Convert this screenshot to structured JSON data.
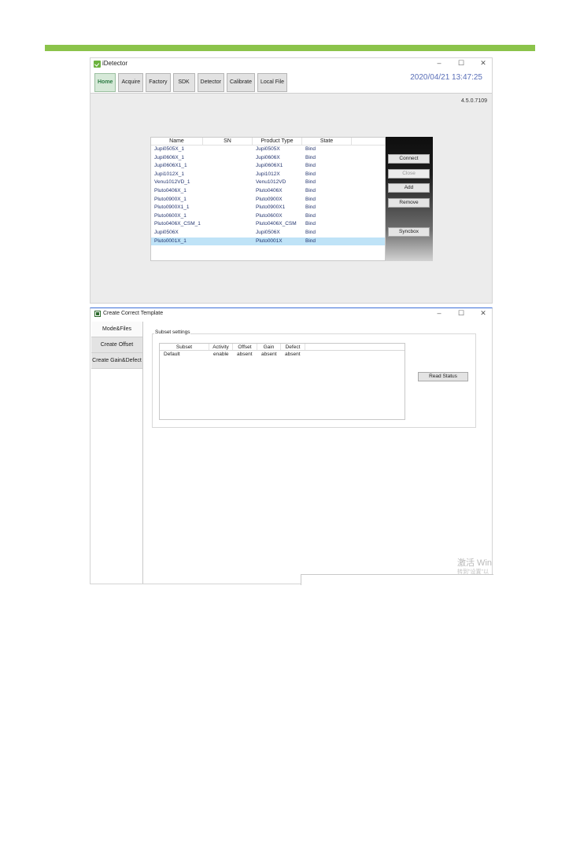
{
  "window1": {
    "title": "iDetector",
    "controls": [
      "–",
      "☐",
      "✕"
    ],
    "tabs": [
      "Home",
      "Acquire",
      "Factory",
      "SDK",
      "Detector",
      "Calibrate",
      "Local File"
    ],
    "active_tab": "Home",
    "datetime": "2020/04/21 13:47:25",
    "version": "4.5.0.7109",
    "list": {
      "columns": [
        "Name",
        "SN",
        "Product Type",
        "State"
      ],
      "rows": [
        [
          "Jupi0505X_1",
          "",
          "Jupi0505X",
          "Bind"
        ],
        [
          "Jupi0606X_1",
          "",
          "Jupi0606X",
          "Bind"
        ],
        [
          "Jupi0606X1_1",
          "",
          "Jupi0606X1",
          "Bind"
        ],
        [
          "Jupi1012X_1",
          "",
          "Jupi1012X",
          "Bind"
        ],
        [
          "Venu1012VD_1",
          "",
          "Venu1012VD",
          "Bind"
        ],
        [
          "Pluto0406X_1",
          "",
          "Pluto0406X",
          "Bind"
        ],
        [
          "Pluto0900X_1",
          "",
          "Pluto0900X",
          "Bind"
        ],
        [
          "Pluto0900X1_1",
          "",
          "Pluto0900X1",
          "Bind"
        ],
        [
          "Pluto0600X_1",
          "",
          "Pluto0600X",
          "Bind"
        ],
        [
          "Pluto0406X_CSM_1",
          "",
          "Pluto0406X_CSM",
          "Bind"
        ],
        [
          "Jupi0506X",
          "",
          "Jupi0506X",
          "Bind"
        ],
        [
          "Pluto0001X_1",
          "",
          "Pluto0001X",
          "Bind"
        ]
      ],
      "selected_index": 11
    },
    "buttons": {
      "connect": "Connect",
      "close": "Close",
      "add": "Add",
      "remove": "Remove",
      "syncbox": "Syncbox"
    }
  },
  "window2": {
    "title": "Create Correct Template",
    "controls": [
      "–",
      "☐",
      "✕"
    ],
    "sidebar_tabs": [
      "Mode&Files",
      "Create Offset",
      "Create Gain&Defect"
    ],
    "group_label": "Subset settings",
    "table": {
      "columns": [
        "Subset",
        "Activity",
        "Offset",
        "Gain",
        "Defect"
      ],
      "rows": [
        [
          "Default",
          "enable",
          "absent",
          "absent",
          "absent"
        ]
      ]
    },
    "read_status_label": "Read Status",
    "watermark_line1": "激活 Win",
    "watermark_line2": "转到\"设置\"以"
  }
}
